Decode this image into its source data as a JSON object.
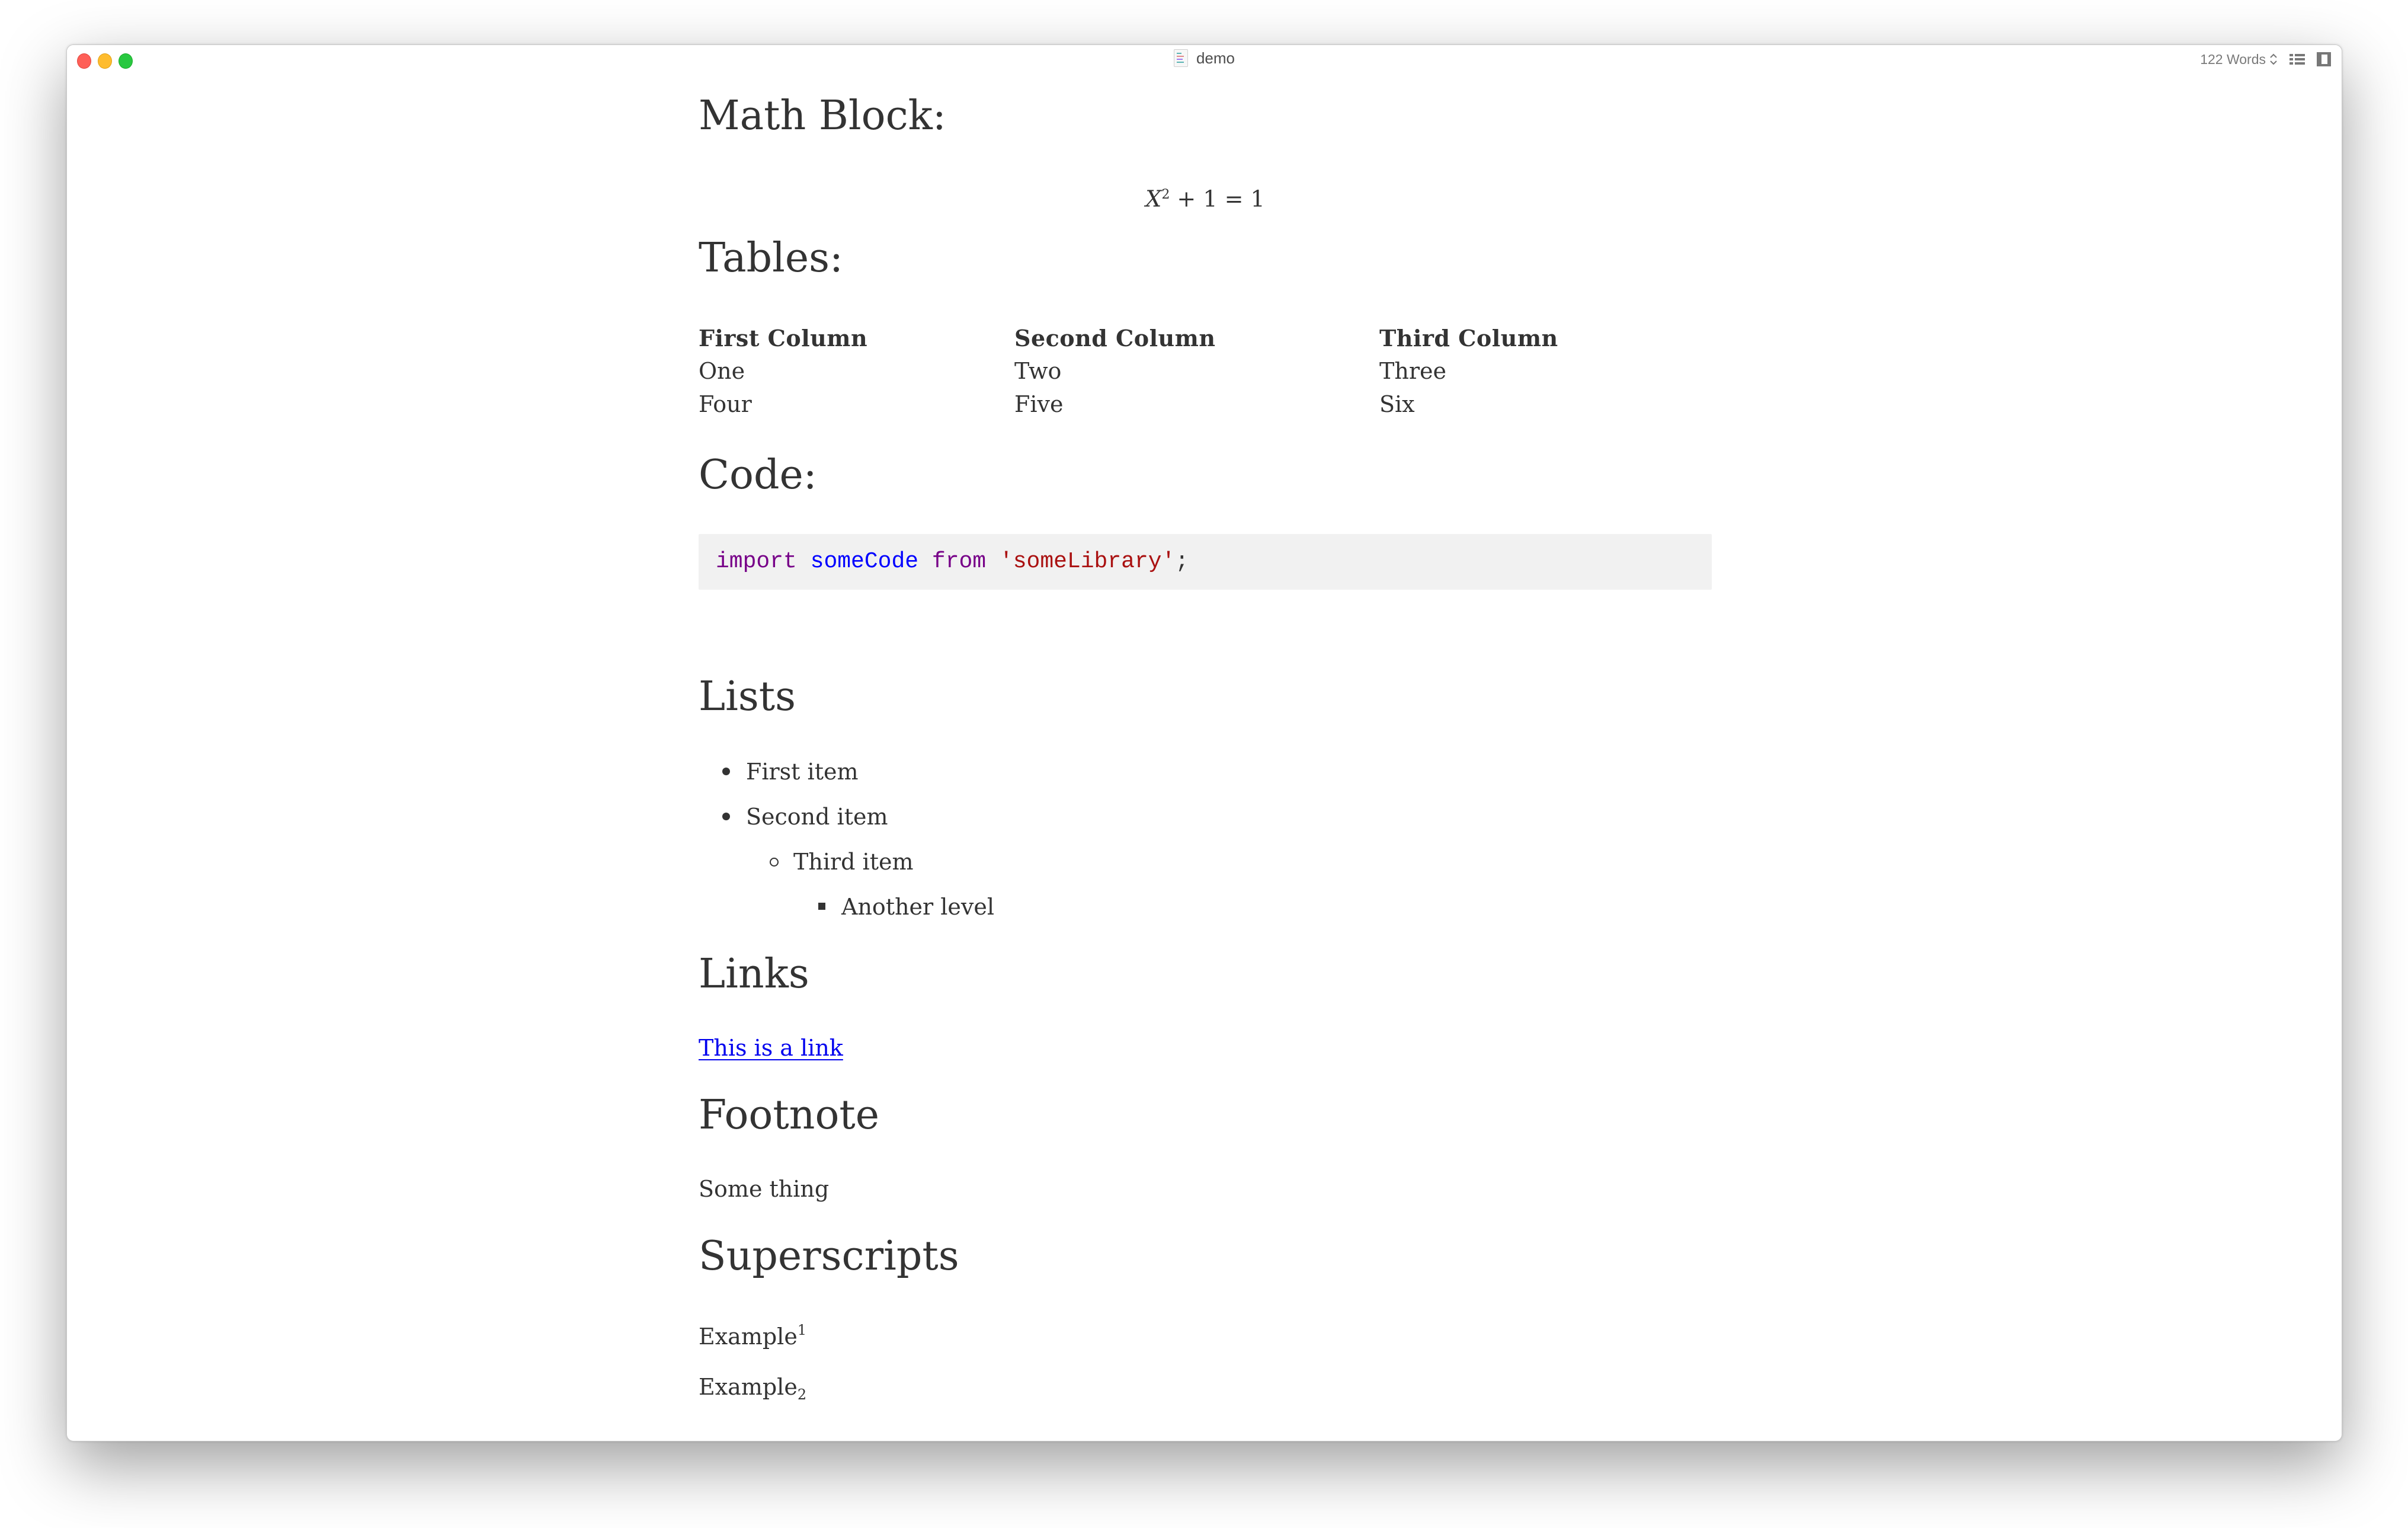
{
  "window": {
    "title": "demo",
    "word_count": "122 Words",
    "controls": [
      "close",
      "minimize",
      "maximize"
    ],
    "colors": {
      "close": "#fe5f57",
      "minimize": "#febc2e",
      "maximize": "#28c840"
    }
  },
  "document": {
    "math_heading": "Math Block:",
    "math_equation": {
      "base": "X",
      "exponent": "2",
      "rest": " + 1 = 1"
    },
    "tables_heading": "Tables:",
    "table": {
      "headers": [
        "First Column",
        "Second Column",
        "Third Column"
      ],
      "rows": [
        [
          "One",
          "Two",
          "Three"
        ],
        [
          "Four",
          "Five",
          "Six"
        ]
      ]
    },
    "code_heading": "Code:",
    "code": {
      "tokens": [
        {
          "text": "import",
          "type": "keyword"
        },
        {
          "text": " ",
          "type": "space"
        },
        {
          "text": "someCode",
          "type": "def"
        },
        {
          "text": " ",
          "type": "space"
        },
        {
          "text": "from",
          "type": "keyword"
        },
        {
          "text": " ",
          "type": "space"
        },
        {
          "text": "'someLibrary'",
          "type": "string"
        },
        {
          "text": ";",
          "type": "punctuation"
        }
      ],
      "colors": {
        "keyword": "#770088",
        "def": "#0000ff",
        "string": "#aa1111",
        "background": "#f1f1f1"
      }
    },
    "lists_heading": "Lists",
    "list_items": [
      {
        "text": "First item",
        "level": 1,
        "marker": "disc"
      },
      {
        "text": "Second item",
        "level": 1,
        "marker": "disc"
      },
      {
        "text": "Third item",
        "level": 2,
        "marker": "circle"
      },
      {
        "text": "Another level",
        "level": 3,
        "marker": "square"
      }
    ],
    "links_heading": "Links",
    "link_text": "This is a link",
    "link_color": "#0000ee",
    "footnote_heading": "Footnote",
    "footnote_text": "Some thing",
    "superscripts_heading": "Superscripts",
    "superscript_example": {
      "base": "Example",
      "sup": "1"
    },
    "subscript_example": {
      "base": "Example",
      "sub": "2"
    }
  }
}
